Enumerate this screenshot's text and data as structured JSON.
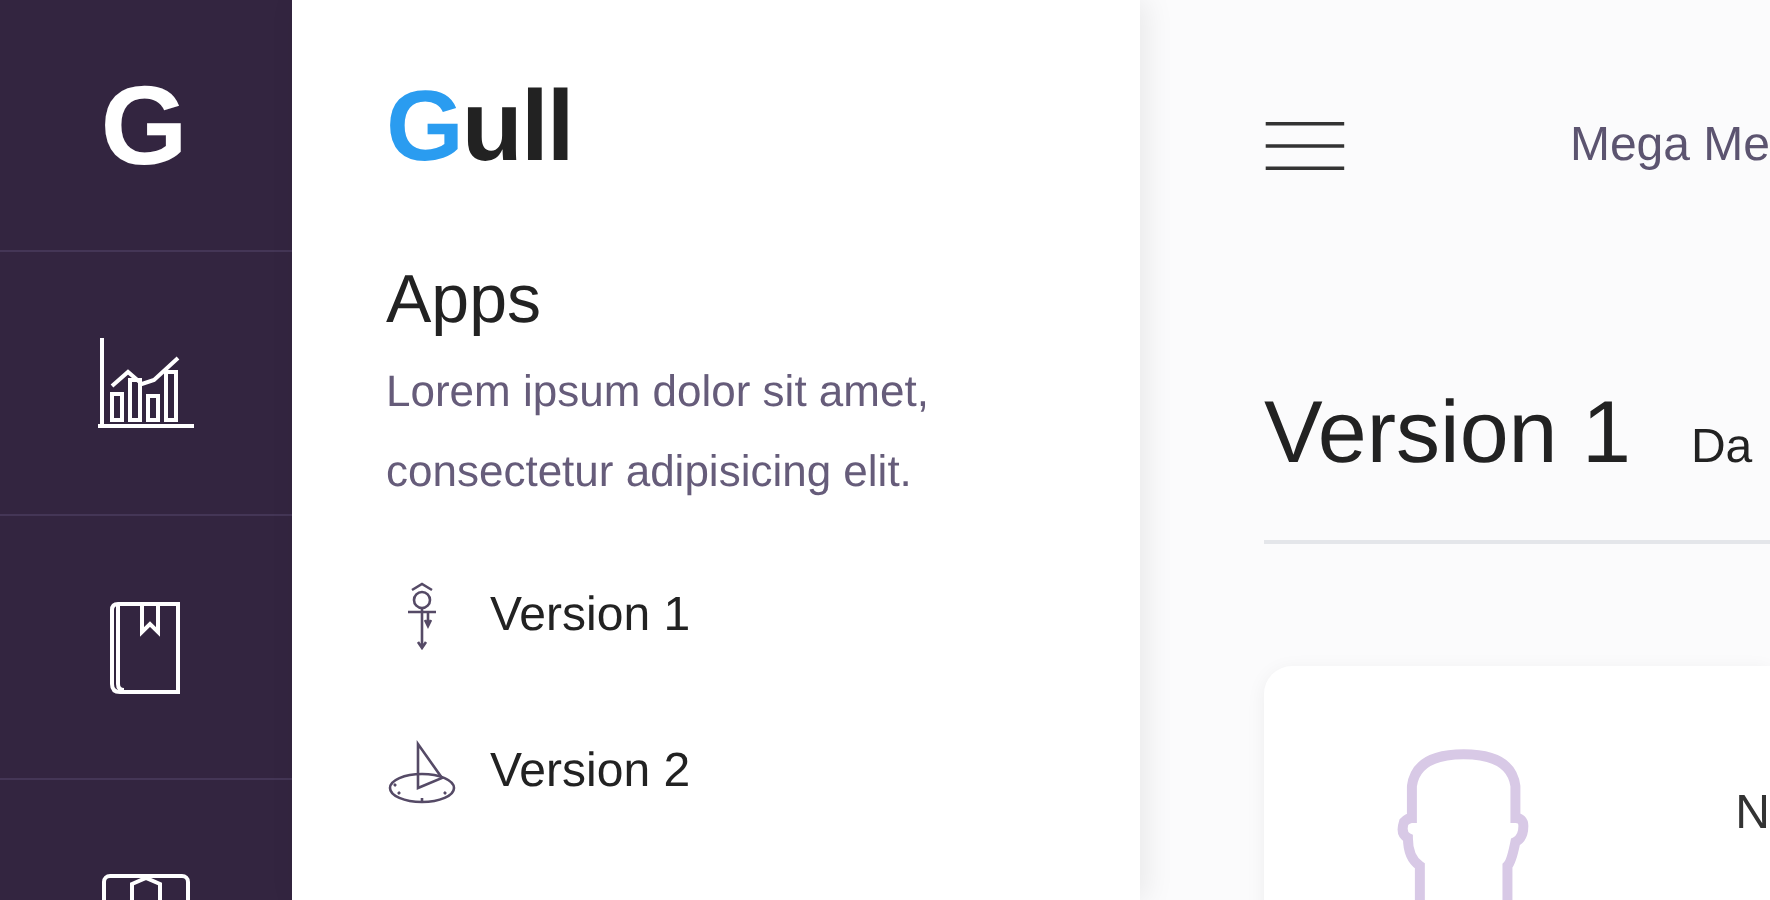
{
  "rail": {
    "logo": "G"
  },
  "panel": {
    "brand": {
      "accent": "G",
      "rest": "ull"
    },
    "title": "Apps",
    "description": "Lorem ipsum dolor sit amet, consectetur adipisicing elit.",
    "items": [
      {
        "label": "Version 1",
        "kind": "pendulum"
      },
      {
        "label": "Version 2",
        "kind": "sundial"
      }
    ]
  },
  "main": {
    "menu_label": "Mega Me",
    "page_title": "Version 1",
    "breadcrumb": "Da",
    "card": {
      "label": "N"
    }
  }
}
